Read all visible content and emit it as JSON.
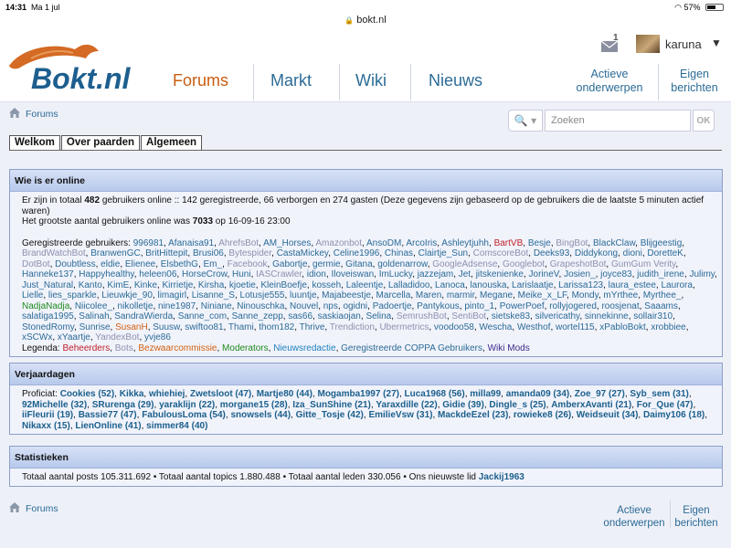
{
  "status_bar": {
    "time": "14:31",
    "date": "Ma 1 jul",
    "battery": "57%",
    "battery_level": 0.57
  },
  "address_bar": {
    "url": "bokt.nl"
  },
  "header": {
    "logo_text": "Bokt.nl",
    "nav": [
      {
        "label": "Forums",
        "active": true
      },
      {
        "label": "Markt",
        "active": false
      },
      {
        "label": "Wiki",
        "active": false
      },
      {
        "label": "Nieuws",
        "active": false
      }
    ],
    "links": [
      {
        "line1": "Actieve",
        "line2": "onderwerpen"
      },
      {
        "line1": "Eigen",
        "line2": "berichten"
      }
    ],
    "messages_count": "1",
    "username": "karuna",
    "caret": "▼"
  },
  "breadcrumb": {
    "label": "Forums"
  },
  "search": {
    "placeholder": "Zoeken",
    "icon_text": "🔍 ▾",
    "ok_label": "OK"
  },
  "subtabs": [
    "Welkom",
    "Over paarden",
    "Algemeen"
  ],
  "online": {
    "title": "Wie is er online",
    "summary_pre": "Er zijn in totaal ",
    "summary_total": "482",
    "summary_post": " gebruikers online :: 142 geregistreerde, 66 verborgen en 274 gasten (Deze gegevens zijn gebaseerd op de gebruikers die de laatste 5 minuten actief waren)",
    "record_pre": "Het grootste aantal gebruikers online was ",
    "record_value": "7033",
    "record_post": " op 16-09-16 23:00",
    "users_label": "Geregistreerde gebruikers: ",
    "users": [
      {
        "n": "996981",
        "t": "u"
      },
      {
        "n": "Afanaisa91",
        "t": "u"
      },
      {
        "n": "AhrefsBot",
        "t": "bot"
      },
      {
        "n": "AM_Horses",
        "t": "u"
      },
      {
        "n": "Amazonbot",
        "t": "bot"
      },
      {
        "n": "AnsoDM",
        "t": "u"
      },
      {
        "n": "ArcoIris",
        "t": "u"
      },
      {
        "n": "Ashleytjuhh",
        "t": "u"
      },
      {
        "n": "BartVB",
        "t": "admin"
      },
      {
        "n": "Besje",
        "t": "u"
      },
      {
        "n": "BingBot",
        "t": "bot"
      },
      {
        "n": "BlackClaw",
        "t": "u"
      },
      {
        "n": "Blijgeestig",
        "t": "u"
      },
      {
        "n": "BrandWatchBot",
        "t": "bot"
      },
      {
        "n": "BranwenGC",
        "t": "u"
      },
      {
        "n": "BritHittepit",
        "t": "u"
      },
      {
        "n": "Brusi06",
        "t": "u"
      },
      {
        "n": "Bytespider",
        "t": "bot"
      },
      {
        "n": "CastaMickey",
        "t": "u"
      },
      {
        "n": "Celine1996",
        "t": "u"
      },
      {
        "n": "Chinas",
        "t": "u"
      },
      {
        "n": "Clairtje_Sun",
        "t": "u"
      },
      {
        "n": "ComscoreBot",
        "t": "bot"
      },
      {
        "n": "Deeks93",
        "t": "u"
      },
      {
        "n": "Diddykong",
        "t": "u"
      },
      {
        "n": "dioni",
        "t": "u"
      },
      {
        "n": "DoretteK",
        "t": "u"
      },
      {
        "n": "DotBot",
        "t": "bot"
      },
      {
        "n": "Doubtless",
        "t": "u"
      },
      {
        "n": "eldie",
        "t": "u"
      },
      {
        "n": "Elienee",
        "t": "u"
      },
      {
        "n": "ElsbethG",
        "t": "u"
      },
      {
        "n": "Em_",
        "t": "u"
      },
      {
        "n": "Facebook",
        "t": "bot"
      },
      {
        "n": "Gabortje",
        "t": "u"
      },
      {
        "n": "germie",
        "t": "u"
      },
      {
        "n": "Gitana",
        "t": "u"
      },
      {
        "n": "goldenarrow",
        "t": "u"
      },
      {
        "n": "GoogleAdsense",
        "t": "bot"
      },
      {
        "n": "Googlebot",
        "t": "bot"
      },
      {
        "n": "GrapeshotBot",
        "t": "bot"
      },
      {
        "n": "GumGum Verity",
        "t": "bot"
      },
      {
        "n": "Hanneke137",
        "t": "u"
      },
      {
        "n": "Happyhealthy",
        "t": "u"
      },
      {
        "n": "heleen06",
        "t": "u"
      },
      {
        "n": "HorseCrow",
        "t": "u"
      },
      {
        "n": "Huni",
        "t": "u"
      },
      {
        "n": "IASCrawler",
        "t": "bot"
      },
      {
        "n": "idion",
        "t": "u"
      },
      {
        "n": "Iloveiswan",
        "t": "u"
      },
      {
        "n": "ImLucky",
        "t": "u"
      },
      {
        "n": "jazzejam",
        "t": "u"
      },
      {
        "n": "Jet",
        "t": "u"
      },
      {
        "n": "jitskenienke",
        "t": "u"
      },
      {
        "n": "JorineV",
        "t": "u"
      },
      {
        "n": "Josien_",
        "t": "u"
      },
      {
        "n": "joyce83",
        "t": "u"
      },
      {
        "n": "judith_irene",
        "t": "u"
      },
      {
        "n": "Julimy",
        "t": "u"
      },
      {
        "n": "Just_Natural",
        "t": "u"
      },
      {
        "n": "Kanto",
        "t": "u"
      },
      {
        "n": "KimE",
        "t": "u"
      },
      {
        "n": "Kinke",
        "t": "u"
      },
      {
        "n": "Kirrietje",
        "t": "u"
      },
      {
        "n": "Kirsha",
        "t": "u"
      },
      {
        "n": "kjoetie",
        "t": "u"
      },
      {
        "n": "KleinBoefje",
        "t": "u"
      },
      {
        "n": "kosseh",
        "t": "u"
      },
      {
        "n": "Laleentje",
        "t": "u"
      },
      {
        "n": "Lalladidoo",
        "t": "u"
      },
      {
        "n": "Lanoca",
        "t": "u"
      },
      {
        "n": "lanouska",
        "t": "u"
      },
      {
        "n": "Larislaatje",
        "t": "u"
      },
      {
        "n": "Larissa123",
        "t": "u"
      },
      {
        "n": "laura_estee",
        "t": "u"
      },
      {
        "n": "Laurora",
        "t": "u"
      },
      {
        "n": "Lielle",
        "t": "u"
      },
      {
        "n": "lies_sparkle",
        "t": "u"
      },
      {
        "n": "Lieuwkje_90",
        "t": "u"
      },
      {
        "n": "limagirl",
        "t": "u"
      },
      {
        "n": "Lisanne_S",
        "t": "u"
      },
      {
        "n": "Lotusje555",
        "t": "u"
      },
      {
        "n": "luuntje",
        "t": "u"
      },
      {
        "n": "Majabeestje",
        "t": "u"
      },
      {
        "n": "Marcella",
        "t": "u"
      },
      {
        "n": "Maren",
        "t": "u"
      },
      {
        "n": "marmir",
        "t": "u"
      },
      {
        "n": "Megane",
        "t": "u"
      },
      {
        "n": "Meike_x_LF",
        "t": "u"
      },
      {
        "n": "Mondy",
        "t": "u"
      },
      {
        "n": "mYrthee",
        "t": "u"
      },
      {
        "n": "Myrthee_",
        "t": "u"
      },
      {
        "n": "NadjaNadja",
        "t": "mod"
      },
      {
        "n": "Niicolee_",
        "t": "u"
      },
      {
        "n": "nikolletje",
        "t": "u"
      },
      {
        "n": "nine1987",
        "t": "u"
      },
      {
        "n": "Niniane",
        "t": "u"
      },
      {
        "n": "Ninouschka",
        "t": "u"
      },
      {
        "n": "Nouvel",
        "t": "u"
      },
      {
        "n": "nps",
        "t": "u"
      },
      {
        "n": "ogidni",
        "t": "u"
      },
      {
        "n": "Padoertje",
        "t": "u"
      },
      {
        "n": "Pantykous",
        "t": "u"
      },
      {
        "n": "pinto_1",
        "t": "u"
      },
      {
        "n": "PowerPoef",
        "t": "u"
      },
      {
        "n": "rollyjogered",
        "t": "u"
      },
      {
        "n": "roosjenat",
        "t": "u"
      },
      {
        "n": "Saaams",
        "t": "u"
      },
      {
        "n": "salatiga1995",
        "t": "u"
      },
      {
        "n": "Salinah",
        "t": "u"
      },
      {
        "n": "SandraWierda",
        "t": "u"
      },
      {
        "n": "Sanne_com",
        "t": "u"
      },
      {
        "n": "Sanne_zepp",
        "t": "u"
      },
      {
        "n": "sas66",
        "t": "u"
      },
      {
        "n": "saskiaojan",
        "t": "u"
      },
      {
        "n": "Selina",
        "t": "u"
      },
      {
        "n": "SemrushBot",
        "t": "bot"
      },
      {
        "n": "SentiBot",
        "t": "bot"
      },
      {
        "n": "sietske83",
        "t": "u"
      },
      {
        "n": "silvericathy",
        "t": "u"
      },
      {
        "n": "sinnekinne",
        "t": "u"
      },
      {
        "n": "sollair310",
        "t": "u"
      },
      {
        "n": "StonedRomy",
        "t": "u"
      },
      {
        "n": "Sunrise",
        "t": "u"
      },
      {
        "n": "SusanH",
        "t": "bezwaar"
      },
      {
        "n": "Suusw",
        "t": "u"
      },
      {
        "n": "swiftoo81",
        "t": "u"
      },
      {
        "n": "Thami",
        "t": "u"
      },
      {
        "n": "thom182",
        "t": "u"
      },
      {
        "n": "Thrive",
        "t": "u"
      },
      {
        "n": "Trendiction",
        "t": "bot"
      },
      {
        "n": "Ubermetrics",
        "t": "bot"
      },
      {
        "n": "voodoo58",
        "t": "u"
      },
      {
        "n": "Wescha",
        "t": "u"
      },
      {
        "n": "Westhof",
        "t": "u"
      },
      {
        "n": "wortel115",
        "t": "u"
      },
      {
        "n": "xPabloBokt",
        "t": "u"
      },
      {
        "n": "xrobbiee",
        "t": "u"
      },
      {
        "n": "xSCWx",
        "t": "u"
      },
      {
        "n": "xYaartje",
        "t": "u"
      },
      {
        "n": "YandexBot",
        "t": "bot"
      },
      {
        "n": "yvje86",
        "t": "u"
      }
    ],
    "legend_label": "Legenda: ",
    "legend": [
      {
        "n": "Beheerders",
        "t": "admin"
      },
      {
        "n": "Bots",
        "t": "bot"
      },
      {
        "n": "Bezwaarcommissie",
        "t": "bezwaar"
      },
      {
        "n": "Moderators",
        "t": "mod"
      },
      {
        "n": "Nieuwsredactie",
        "t": "redactie"
      },
      {
        "n": "Geregistreerde COPPA Gebruikers",
        "t": "coppa"
      },
      {
        "n": "Wiki Mods",
        "t": "wiki"
      }
    ]
  },
  "birthdays": {
    "title": "Verjaardagen",
    "label": "Proficiat: ",
    "items": [
      "Cookies (52)",
      "Kikka",
      "whiehiej",
      "Zwetsloot (47)",
      "Martje80 (44)",
      "Mogamba1997 (27)",
      "Luca1968 (56)",
      "milla99",
      "amanda09 (34)",
      "Zoe_97 (27)",
      "Syb_sem (31)",
      "92Michelle (32)",
      "SRurenga (29)",
      "yaraklijn (22)",
      "morgane15 (28)",
      "Iza_SunShine (21)",
      "Yaraxdille (22)",
      "Gidie (39)",
      "Dingle_s (25)",
      "AmberxAvanti (21)",
      "For_Que (47)",
      "iiFleurii (19)",
      "Bassie77 (47)",
      "FabulousLoma (54)",
      "snowsels (44)",
      "Gitte_Tosje (42)",
      "EmilieVsw (31)",
      "MackdeEzel (23)",
      "rowieke8 (26)",
      "Weidseuit (34)",
      "Daimy106 (18)",
      "Nikaxx (15)",
      "LienOnline (41)",
      "simmer84 (40)"
    ]
  },
  "stats": {
    "title": "Statistieken",
    "text": "Totaal aantal posts 105.311.692 • Totaal aantal topics 1.880.488 • Totaal aantal leden 330.056 • Ons nieuwste lid ",
    "newest_member": "Jackij1963"
  },
  "footer": {
    "breadcrumb": "Forums",
    "links": [
      {
        "line1": "Actieve",
        "line2": "onderwerpen"
      },
      {
        "line1": "Eigen",
        "line2": "berichten"
      }
    ]
  },
  "colors": {
    "link": "#2b6b96",
    "active_nav": "#c85e12",
    "admin": "#c0202a",
    "moderator": "#1d8a1d",
    "bot": "#8f8fad",
    "bezwaar": "#d06010",
    "redactie": "#1e80c0",
    "wiki_mod": "#3a2a8a",
    "panel_head": "#c4d3f0"
  }
}
